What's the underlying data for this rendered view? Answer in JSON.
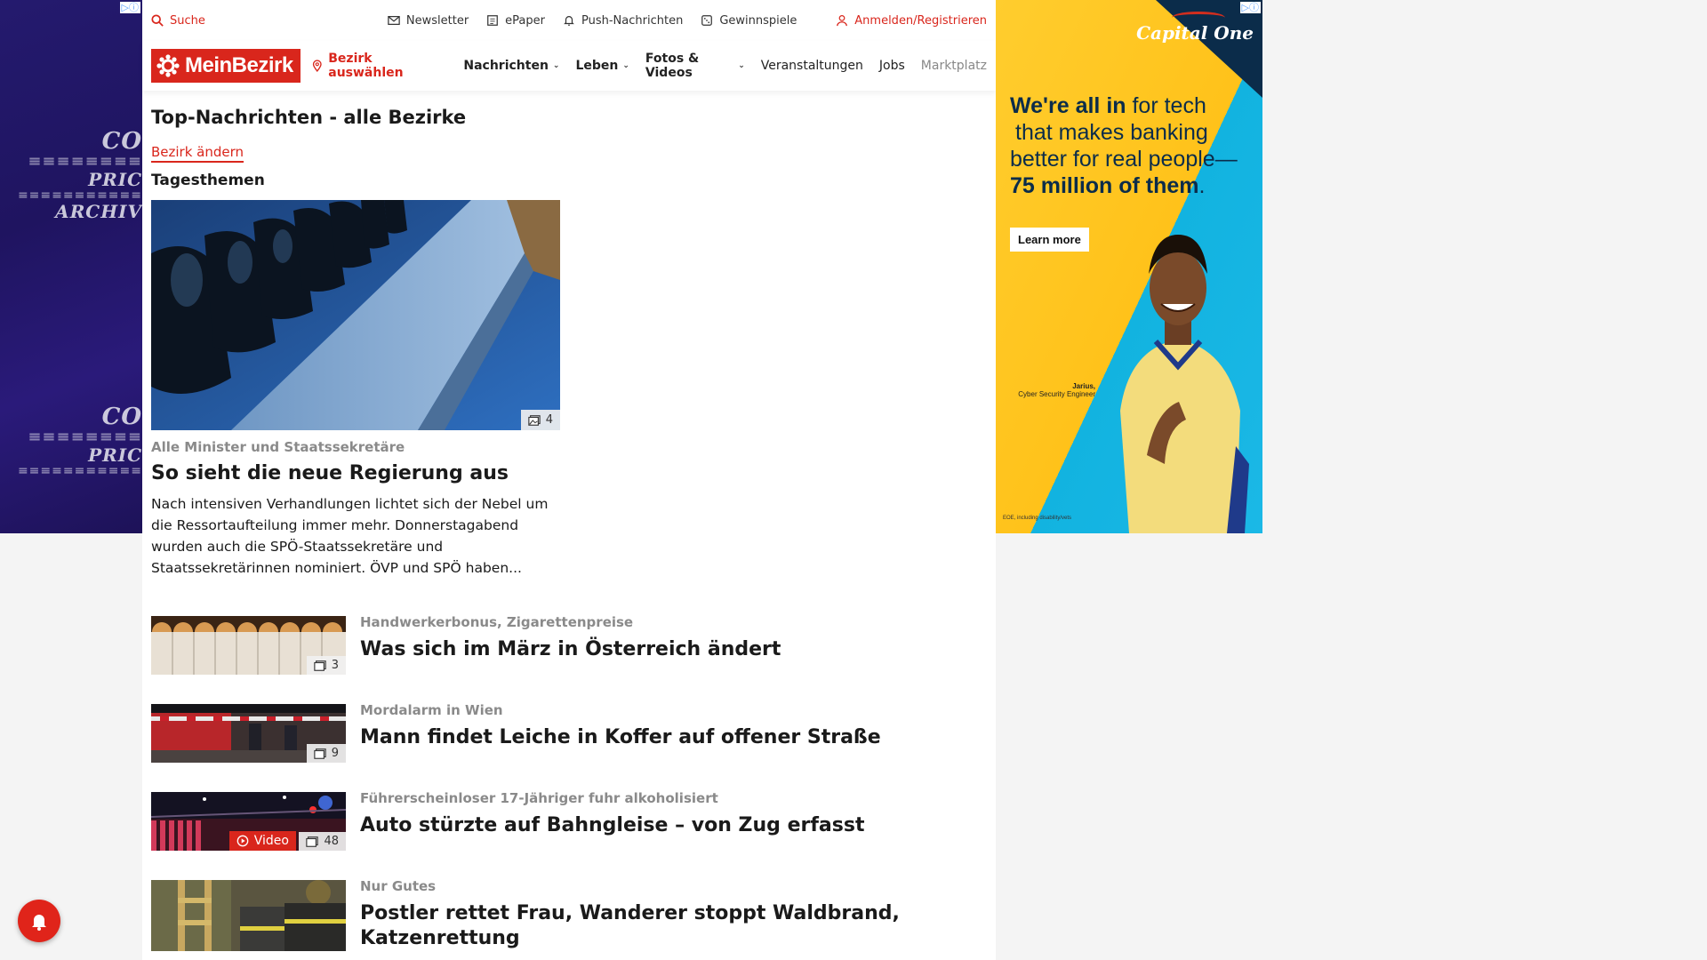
{
  "left_ad": {
    "ad_marker": "▷ⓘ",
    "lines": [
      "CO",
      "PRIC",
      "ARCHIV"
    ]
  },
  "topbar": {
    "search": "Suche",
    "links": [
      "Newsletter",
      "ePaper",
      "Push-Nachrichten",
      "Gewinnspiele"
    ],
    "login": "Anmelden/Registrieren"
  },
  "navbar": {
    "logo": "MeinBezirk",
    "select_district": "Bezirk auswählen",
    "items": [
      {
        "label": "Nachrichten",
        "dropdown": true
      },
      {
        "label": "Leben",
        "dropdown": true
      },
      {
        "label": "Fotos & Videos",
        "dropdown": true
      },
      {
        "label": "Veranstaltungen",
        "dropdown": false
      },
      {
        "label": "Jobs",
        "dropdown": false
      },
      {
        "label": "Marktplatz",
        "dropdown": false
      }
    ]
  },
  "page": {
    "title": "Top-Nachrichten - alle Bezirke",
    "change_district": "Bezirk ändern",
    "section": "Tagesthemen"
  },
  "hero": {
    "image_count": "4",
    "kicker": "Alle Minister und Staatssekretäre",
    "title": "So sieht die neue Regierung aus",
    "teaser": "Nach intensiven Verhandlungen lichtet sich der Nebel um die Ressortaufteilung immer mehr. Donnerstagabend wurden auch die SPÖ-Staatssekretäre und Staatssekretärinnen nominiert. ÖVP und SPÖ haben..."
  },
  "articles": [
    {
      "kicker": "Handwerkerbonus, Zigarettenpreise",
      "title": "Was sich im März in Österreich ändert",
      "image_count": "3",
      "video": ""
    },
    {
      "kicker": "Mordalarm in Wien",
      "title": "Mann findet Leiche in Koffer auf offener Straße",
      "image_count": "9",
      "video": ""
    },
    {
      "kicker": "Führerscheinloser 17-Jähriger fuhr alkoholisiert",
      "title": "Auto stürzte auf Bahngleise – von Zug erfasst",
      "image_count": "48",
      "video": "Video"
    },
    {
      "kicker": "Nur Gutes",
      "title": "Postler rettet Frau, Wanderer stoppt Waldbrand, Katzenrettung",
      "image_count": "",
      "video": ""
    }
  ],
  "right_ad": {
    "ad_marker": "▷ⓘ",
    "brand": "Capital One",
    "copy_bold_1": "We're all in",
    "copy_1": " for tech",
    "copy_2": "that makes banking",
    "copy_3": "better for real people—",
    "copy_bold_2": "75 million of them",
    "copy_end": ".",
    "cta": "Learn more",
    "person_name": "Jarius,",
    "person_role": "Cyber Security Engineer",
    "fine_print": "EOE, including disability/vets"
  },
  "colors": {
    "brand_red": "#d9261c",
    "ad_navy": "#0b2c4a",
    "ad_yellow": "#ffc21a",
    "ad_cyan": "#1bb8e6"
  }
}
